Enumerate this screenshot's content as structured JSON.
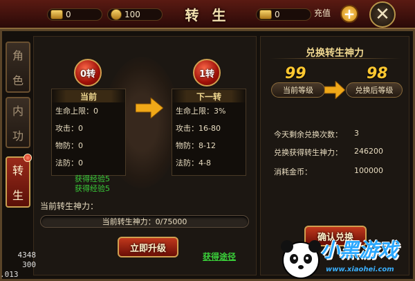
{
  "topbar": {
    "title": "转 生",
    "bars": [
      {
        "icon": "gold-ingot-icon",
        "value": "0"
      },
      {
        "icon": "coin-icon",
        "value": "100"
      },
      {
        "icon": "yuanbao-icon",
        "value": "0"
      }
    ],
    "recharge_label": "充值",
    "plus_label": "+",
    "close_label": "✕"
  },
  "side_tabs": [
    {
      "label_top": "角",
      "label_bottom": "色",
      "active": false
    },
    {
      "label_top": "内",
      "label_bottom": "功",
      "active": false
    },
    {
      "label_top": "转",
      "label_bottom": "生",
      "active": true
    }
  ],
  "current": {
    "gem": "0转",
    "caption": "当前",
    "stats": [
      "生命上限：0",
      "攻击：0",
      "物防：0",
      "法防：0"
    ]
  },
  "next": {
    "gem": "1转",
    "caption": "下一转",
    "stats": [
      "生命上限：3%",
      "攻击：16-80",
      "物防：8-12",
      "法防：4-8"
    ]
  },
  "exp_lines": [
    "获得经验5",
    "获得经验5"
  ],
  "power": {
    "label": "当前转生神力：",
    "bar_text": "当前转生神力：0/75000",
    "current": 0,
    "max": 75000
  },
  "upgrade_button": "立即升级",
  "obtain_link": "获得途径",
  "exchange": {
    "title": "兑换转生神力",
    "current_level": "99",
    "current_level_label": "当前等级",
    "after_level": "98",
    "after_level_label": "兑换后等级",
    "rows": [
      {
        "label": "今天剩余兑换次数：",
        "value": "3"
      },
      {
        "label": "兑换获得转生神力：",
        "value": "246200"
      },
      {
        "label": "消耗金币：",
        "value": "100000"
      }
    ],
    "confirm_button": "确认兑换"
  },
  "debug": [
    "4348",
    "300",
    ".013"
  ],
  "watermark": {
    "main": "小黑游戏",
    "url": "www.xiaohei.com"
  },
  "colors": {
    "accent_gold": "#ffc830",
    "green_text": "#3acc3a",
    "button_red": "#c0381c"
  }
}
